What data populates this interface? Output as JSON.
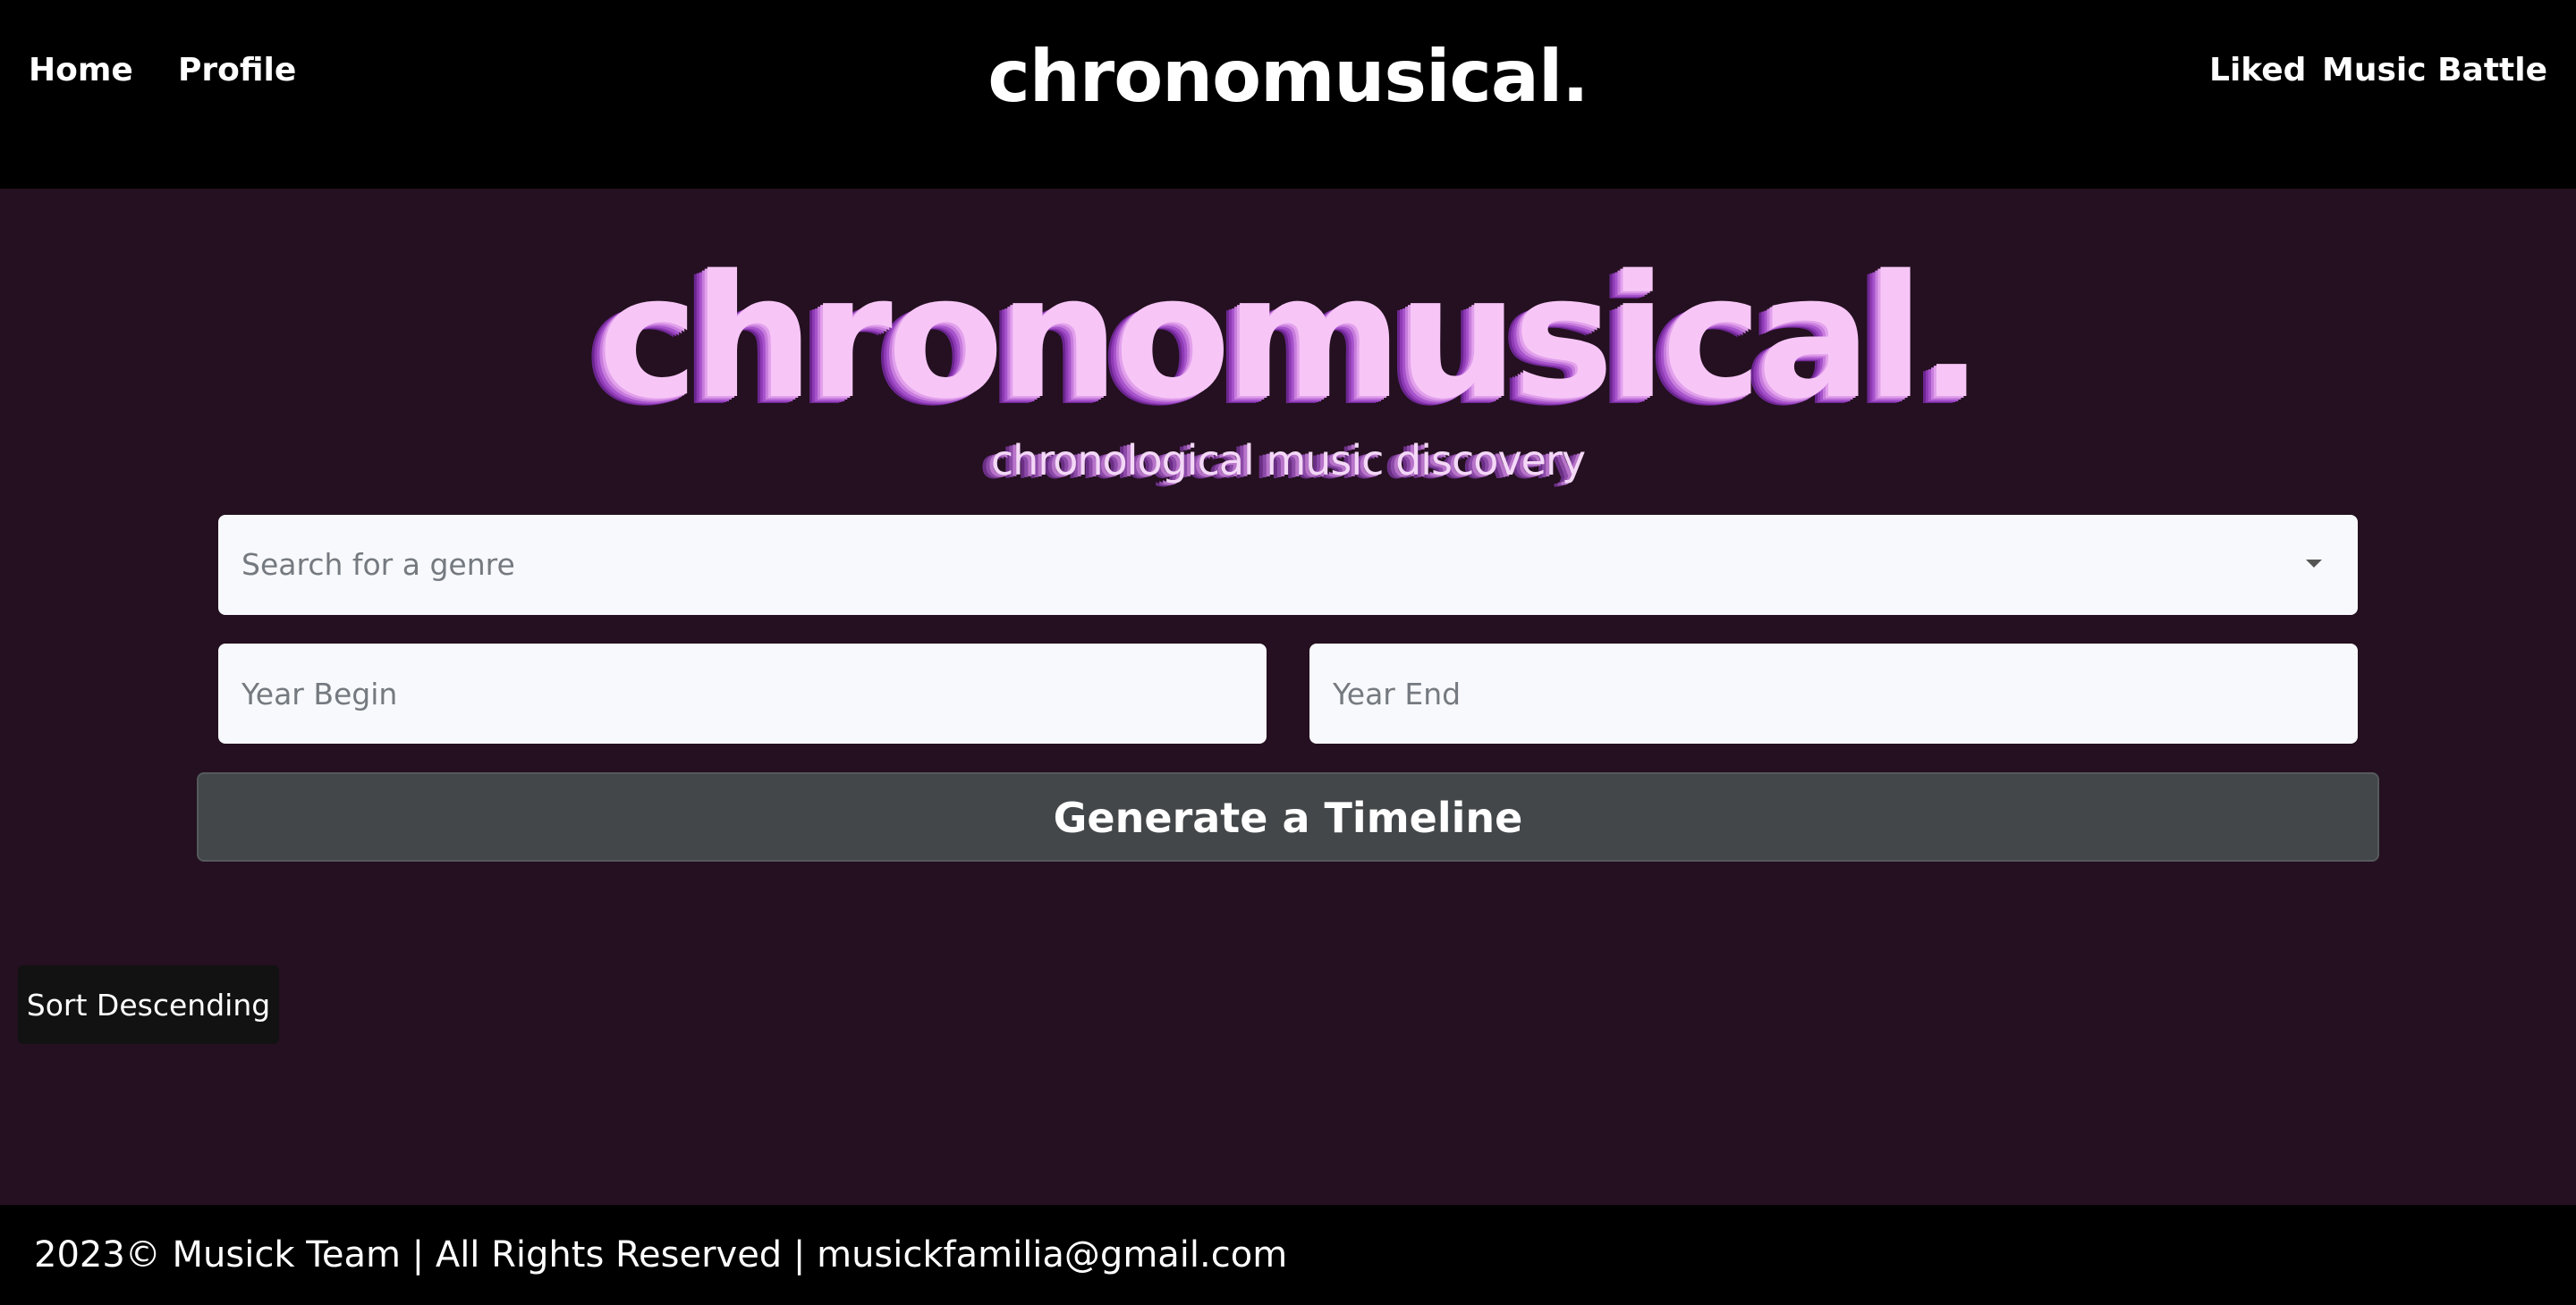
{
  "nav": {
    "home": "Home",
    "profile": "Profile",
    "brand": "chronomusical.",
    "liked": "Liked",
    "music_battle": "Music Battle"
  },
  "hero": {
    "title": "chronomusical.",
    "subtitle": "chronological music discovery"
  },
  "form": {
    "genre_placeholder": "Search for a genre",
    "year_begin_placeholder": "Year Begin",
    "year_end_placeholder": "Year End",
    "generate_label": "Generate a Timeline"
  },
  "sort": {
    "label": "Sort Descending"
  },
  "footer": {
    "text": "2023© Musick Team | All Rights Reserved | musickfamilia@gmail.com"
  },
  "colors": {
    "background": "#241020",
    "nav_background": "#000000",
    "hero_title": "#f7c6f7",
    "hero_shadow": "#8f3bb5",
    "button": "#434749"
  },
  "icons": {
    "genre_dropdown": "chevron-down-icon"
  }
}
